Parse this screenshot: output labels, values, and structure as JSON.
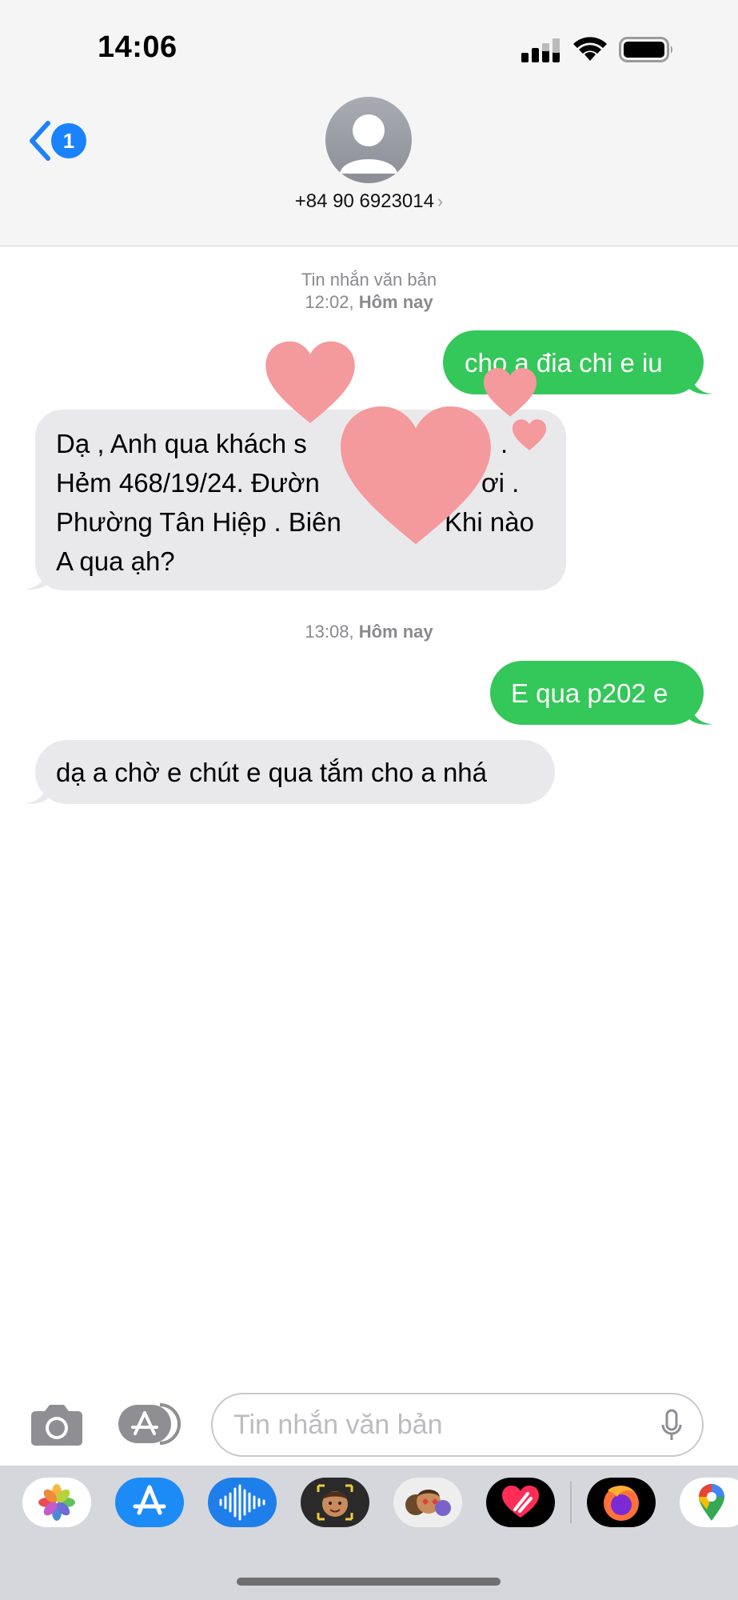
{
  "status_bar": {
    "time": "14:06",
    "icons": [
      "cellular-signal-icon",
      "wifi-icon",
      "battery-icon"
    ]
  },
  "header": {
    "back_badge": "1",
    "contact_name": "+84 90 6923014",
    "contact_chevron": "›"
  },
  "timestamps": [
    {
      "label": "Tin nhắn văn bản",
      "time": "12:02,",
      "day": "Hôm nay"
    },
    {
      "time": "13:08,",
      "day": "Hôm nay"
    }
  ],
  "messages": [
    {
      "direction": "outgoing",
      "text": "cho a đia chi e iu"
    },
    {
      "direction": "incoming",
      "lines": [
        "Dạ , Anh  qua khách s",
        "Hẻm 468/19/24. Đườn",
        "Phường Tân Hiệp . Biên",
        "A qua ạh?"
      ],
      "fragments": [
        ".",
        "ơi .",
        "Khi nào"
      ]
    },
    {
      "direction": "outgoing",
      "text": "E qua p202 e"
    },
    {
      "direction": "incoming",
      "text": "dạ a chờ e chút e qua tắm cho a nhá"
    }
  ],
  "compose": {
    "placeholder": "Tin nhắn văn bản"
  },
  "app_drawer": [
    "photos-app-icon",
    "app-store-app-icon",
    "audio-message-app-icon",
    "memoji-app-icon",
    "memoji-stickers-app-icon",
    "digital-touch-app-icon",
    "firefox-app-icon",
    "google-maps-app-icon"
  ],
  "colors": {
    "outgoing_bubble": "#34c759",
    "incoming_bubble": "#e9e9eb",
    "accent": "#1a82fb",
    "hearts": "#f4999c"
  }
}
